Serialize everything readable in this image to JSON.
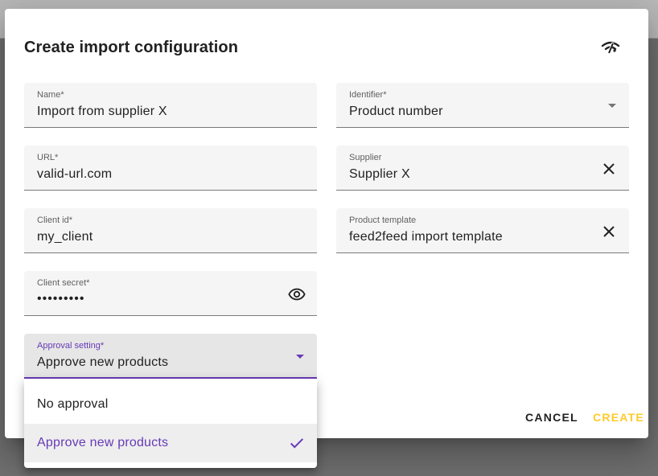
{
  "dialog": {
    "title": "Create import configuration",
    "header_icon": "signal-off-icon"
  },
  "fields": {
    "name": {
      "label": "Name*",
      "value": "Import from supplier X"
    },
    "identifier": {
      "label": "Identifier*",
      "value": "Product number"
    },
    "url": {
      "label": "URL*",
      "value": "valid-url.com"
    },
    "supplier": {
      "label": "Supplier",
      "value": "Supplier X"
    },
    "client_id": {
      "label": "Client id*",
      "value": "my_client"
    },
    "product_template": {
      "label": "Product template",
      "value": "feed2feed import template"
    },
    "client_secret": {
      "label": "Client secret*",
      "value": "•••••••••"
    },
    "approval_setting": {
      "label": "Approval setting*",
      "value": "Approve new products"
    }
  },
  "dropdown": {
    "options": [
      {
        "label": "No approval",
        "selected": false
      },
      {
        "label": "Approve new products",
        "selected": true
      }
    ]
  },
  "actions": {
    "cancel_label": "CANCEL",
    "create_label": "CREATE"
  },
  "colors": {
    "accent": "#673ab7",
    "create": "#ffca28",
    "field_bg": "#f5f5f5"
  }
}
